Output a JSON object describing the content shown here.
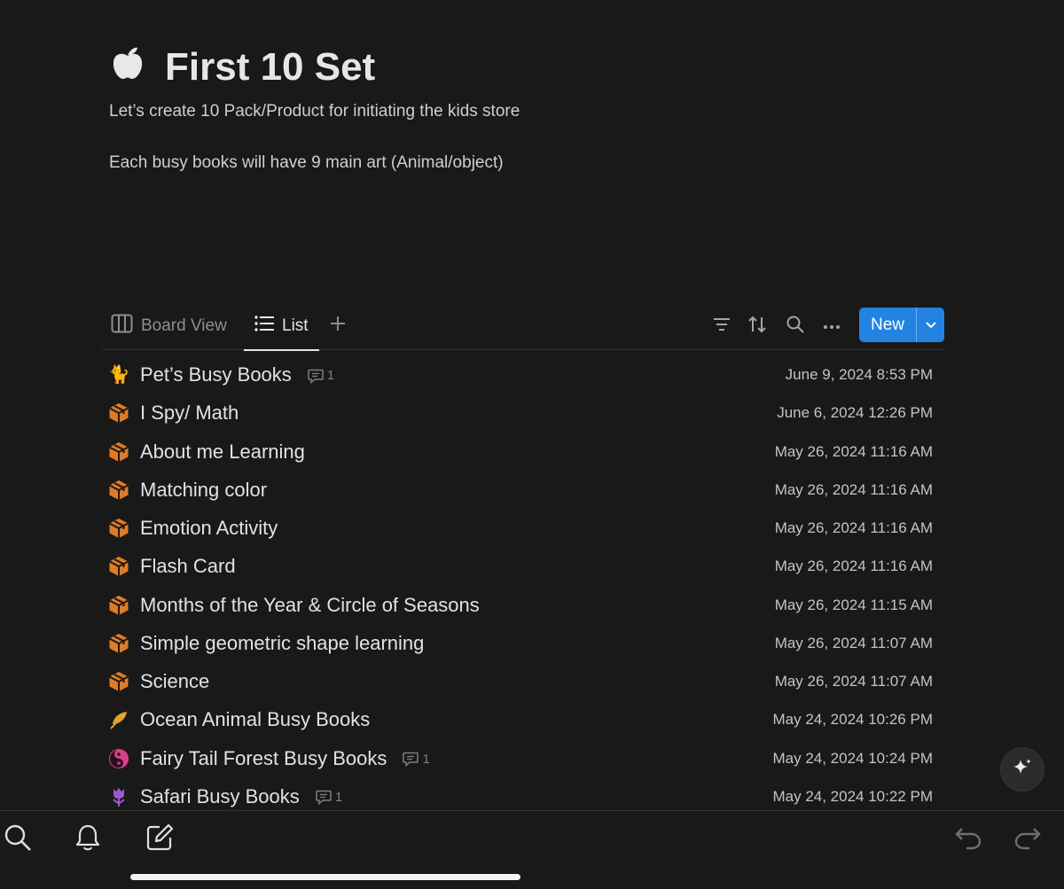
{
  "page": {
    "title": "First 10 Set",
    "icon": "apple-icon",
    "description": [
      "Let’s create 10 Pack/Product for initiating the kids store",
      "Each busy books will have 9 main art (Animal/object)"
    ]
  },
  "tabs": [
    {
      "label": "Board View",
      "icon": "board-view-icon",
      "active": false
    },
    {
      "label": "List",
      "icon": "list-icon",
      "active": true
    }
  ],
  "toolbar": {
    "new_label": "New",
    "icons": [
      "filter-icon",
      "sort-icon",
      "search-icon",
      "more-icon"
    ]
  },
  "colors": {
    "background": "#191919",
    "accent": "#2383e2",
    "box_icon": "#e07b24"
  },
  "rows": [
    {
      "icon": "cat-icon",
      "title": "Pet’s Busy Books",
      "comments": "1",
      "date": "June 9, 2024 8:53 PM"
    },
    {
      "icon": "box-icon",
      "title": "I Spy/ Math",
      "comments": "",
      "date": "June 6, 2024 12:26 PM"
    },
    {
      "icon": "box-icon",
      "title": "About me Learning",
      "comments": "",
      "date": "May 26, 2024 11:16 AM"
    },
    {
      "icon": "box-icon",
      "title": "Matching color",
      "comments": "",
      "date": "May 26, 2024 11:16 AM"
    },
    {
      "icon": "box-icon",
      "title": "Emotion Activity",
      "comments": "",
      "date": "May 26, 2024 11:16 AM"
    },
    {
      "icon": "box-icon",
      "title": "Flash Card",
      "comments": "",
      "date": "May 26, 2024 11:16 AM"
    },
    {
      "icon": "box-icon",
      "title": "Months of the Year & Circle of Seasons",
      "comments": "",
      "date": "May 26, 2024 11:15 AM"
    },
    {
      "icon": "box-icon",
      "title": "Simple geometric shape learning",
      "comments": "",
      "date": "May 26, 2024 11:07 AM"
    },
    {
      "icon": "box-icon",
      "title": "Science",
      "comments": "",
      "date": "May 26, 2024 11:07 AM"
    },
    {
      "icon": "feather-icon",
      "title": "Ocean Animal Busy Books",
      "comments": "",
      "date": "May 24, 2024 10:26 PM"
    },
    {
      "icon": "yin-yang-icon",
      "title": "Fairy Tail Forest Busy Books",
      "comments": "1",
      "date": "May 24, 2024 10:24 PM"
    },
    {
      "icon": "tulip-icon",
      "title": "Safari Busy Books",
      "comments": "1",
      "date": "May 24, 2024 10:22 PM"
    }
  ],
  "bottom_bar": {
    "icons": [
      "search-icon",
      "bell-icon",
      "compose-icon",
      "undo-icon",
      "redo-icon"
    ]
  }
}
